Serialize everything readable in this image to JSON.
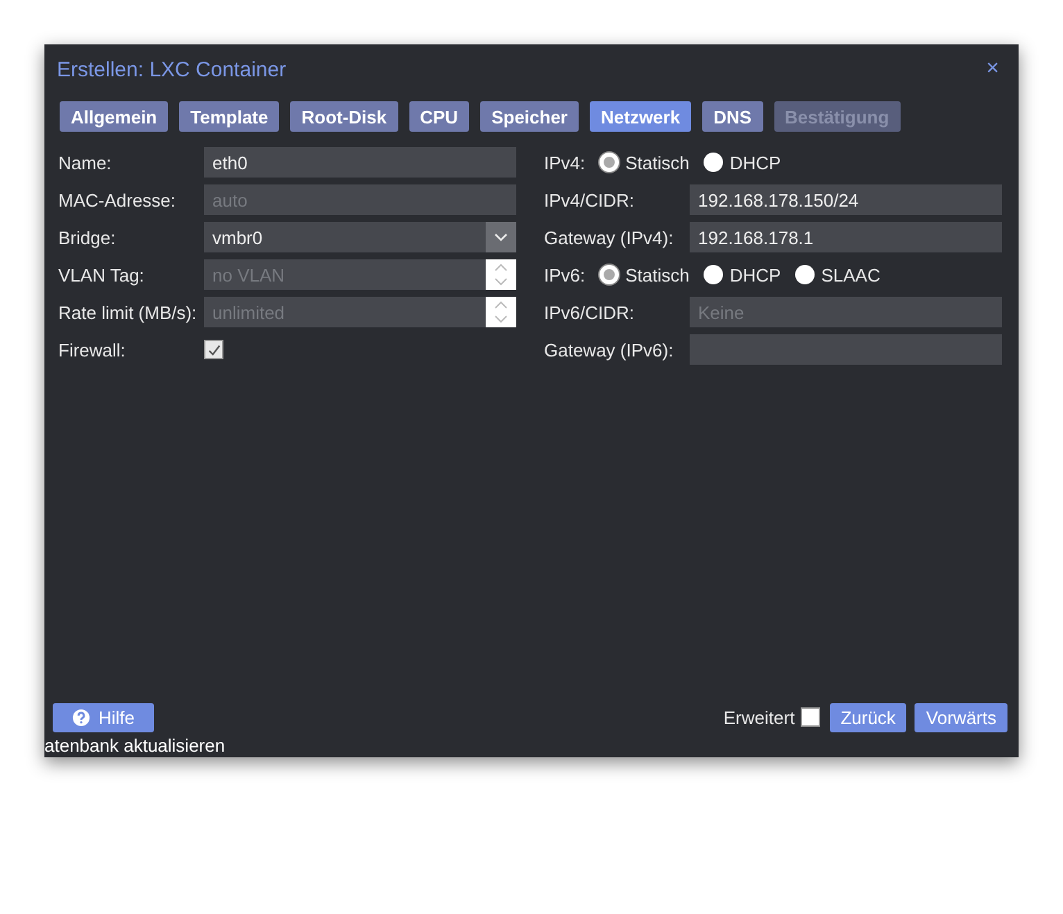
{
  "window": {
    "title": "Erstellen: LXC Container",
    "close": "×"
  },
  "tabs": [
    {
      "label": "Allgemein",
      "selected": false,
      "disabled": false
    },
    {
      "label": "Template",
      "selected": false,
      "disabled": false
    },
    {
      "label": "Root-Disk",
      "selected": false,
      "disabled": false
    },
    {
      "label": "CPU",
      "selected": false,
      "disabled": false
    },
    {
      "label": "Speicher",
      "selected": false,
      "disabled": false
    },
    {
      "label": "Netzwerk",
      "selected": true,
      "disabled": false
    },
    {
      "label": "DNS",
      "selected": false,
      "disabled": false
    },
    {
      "label": "Bestätigung",
      "selected": false,
      "disabled": true
    }
  ],
  "left_fields": [
    {
      "kind": "text",
      "label": "Name:",
      "value": "eth0"
    },
    {
      "kind": "text",
      "label": "MAC-Adresse:",
      "placeholder": "auto"
    },
    {
      "kind": "combo",
      "label": "Bridge:",
      "value": "vmbr0"
    },
    {
      "kind": "spinner",
      "label": "VLAN Tag:",
      "placeholder": "no VLAN"
    },
    {
      "kind": "spinner",
      "label": "Rate limit (MB/s):",
      "placeholder": "unlimited"
    },
    {
      "kind": "checkbox",
      "label": "Firewall:",
      "checked": true
    }
  ],
  "right_fields": [
    {
      "kind": "radio",
      "label": "IPv4:",
      "options": [
        {
          "label": "Statisch",
          "selected": true
        },
        {
          "label": "DHCP",
          "selected": false
        }
      ]
    },
    {
      "kind": "text",
      "label": "IPv4/CIDR:",
      "value": "192.168.178.150/24"
    },
    {
      "kind": "text",
      "label": "Gateway (IPv4):",
      "value": "192.168.178.1"
    },
    {
      "kind": "radio",
      "label": "IPv6:",
      "options": [
        {
          "label": "Statisch",
          "selected": true
        },
        {
          "label": "DHCP",
          "selected": false
        },
        {
          "label": "SLAAC",
          "selected": false
        }
      ]
    },
    {
      "kind": "text",
      "label": "IPv6/CIDR:",
      "placeholder": "Keine"
    },
    {
      "kind": "text",
      "label": "Gateway (IPv6):"
    }
  ],
  "footer": {
    "help": "Hilfe",
    "advanced": {
      "label": "Erweitert",
      "checked": false
    },
    "buttons": [
      "Zurück",
      "Vorwärts"
    ]
  },
  "background_text": "atenbank aktualisieren"
}
